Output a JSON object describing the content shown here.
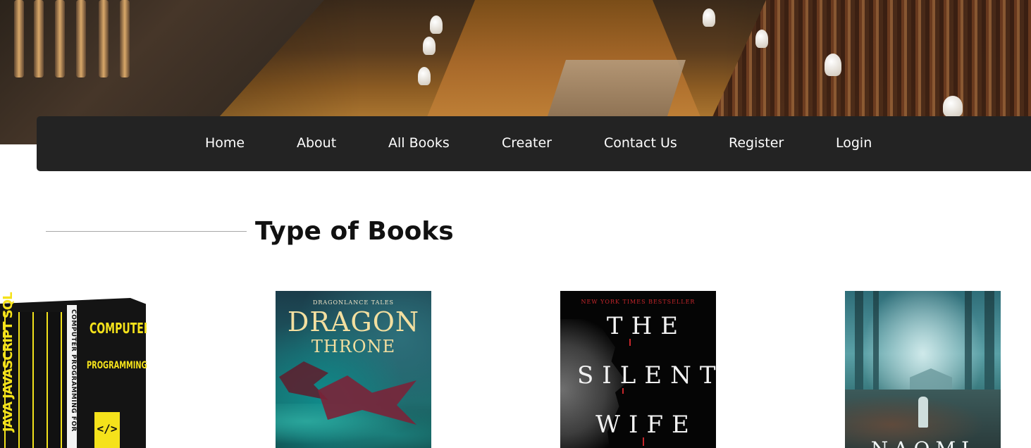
{
  "nav": {
    "items": [
      {
        "label": "Home"
      },
      {
        "label": "About"
      },
      {
        "label": "All Books"
      },
      {
        "label": "Creater"
      },
      {
        "label": "Contact Us"
      },
      {
        "label": "Register"
      },
      {
        "label": "Login"
      }
    ],
    "background": "#232323",
    "text_color": "#ffffff"
  },
  "section": {
    "title": "Type of Books"
  },
  "books": [
    {
      "cover_title": "COMPUTER",
      "cover_subtitle": "PROGRAMMING",
      "spine_text": "JAVA JAVASCRIPT SQL C++ C# PYTHON PHP HTML AND CSS",
      "side_text": "COMPUTER PROGRAMMING FOR",
      "badge": "</>",
      "accent": "#f5e21b"
    },
    {
      "series": "DRAGONLANCE TALES",
      "title_line1": "DRAGON",
      "title_line2": "THRONE"
    },
    {
      "tagline": "NEW YORK TIMES BESTSELLER",
      "title_line1": "THE",
      "title_line2": "SILENT",
      "title_line3": "WIFE"
    },
    {
      "author_partial": "NAOMI"
    }
  ]
}
